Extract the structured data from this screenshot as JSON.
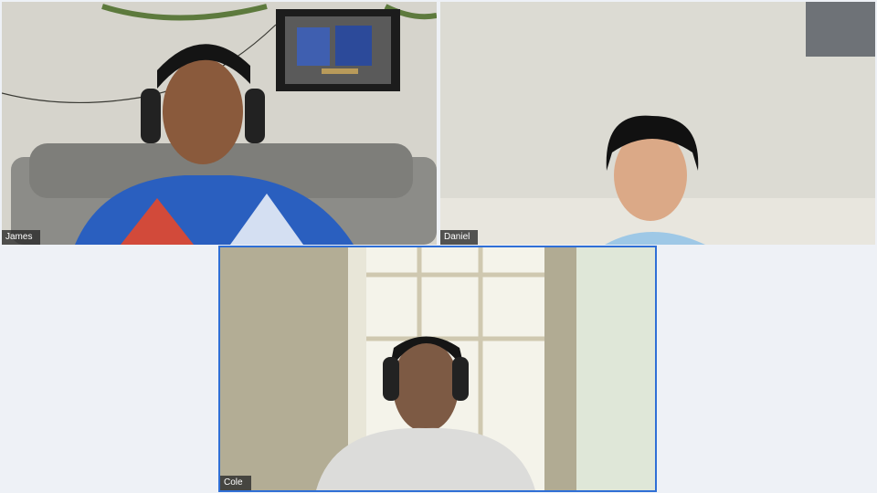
{
  "participants": [
    {
      "name": "James",
      "active": false
    },
    {
      "name": "Daniel",
      "active": false
    },
    {
      "name": "Cole",
      "active": true
    }
  ],
  "colors": {
    "active_border": "#2f6fd6",
    "background": "#eef1f6"
  }
}
